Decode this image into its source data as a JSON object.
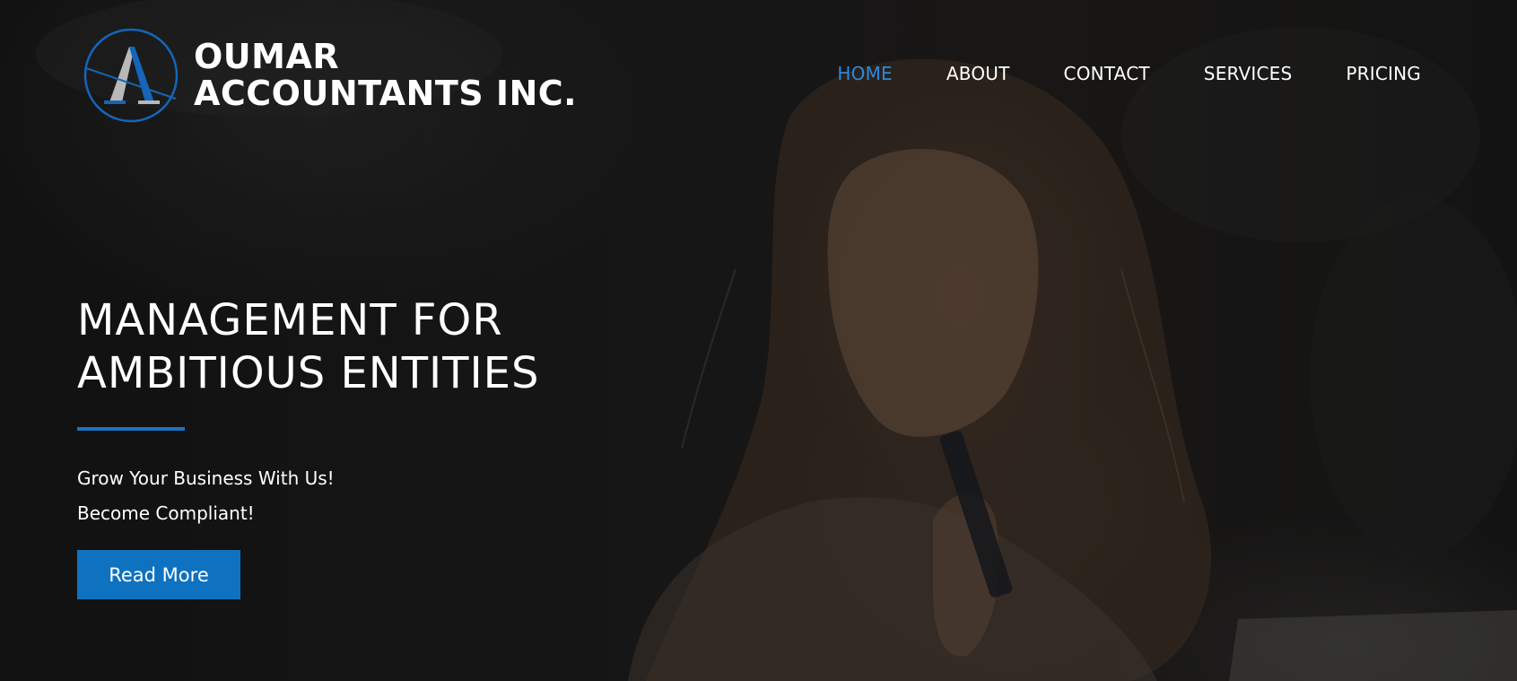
{
  "brand": {
    "line1": "OUMAR",
    "line2": "ACCOUNTANTS INC.",
    "logo_icon": "letter-a-circle-logo",
    "colors": {
      "accent": "#1a73c0",
      "logo_blue": "#1565b8",
      "logo_gray": "#b8b8b8"
    }
  },
  "nav": {
    "items": [
      {
        "label": "HOME",
        "active": true
      },
      {
        "label": "ABOUT",
        "active": false
      },
      {
        "label": "CONTACT",
        "active": false
      },
      {
        "label": "SERVICES",
        "active": false
      },
      {
        "label": "PRICING",
        "active": false
      }
    ],
    "active_color": "#2a8ae0"
  },
  "hero": {
    "headline_line1": "MANAGEMENT FOR",
    "headline_line2": "AMBITIOUS ENTITIES",
    "tagline1": "Grow Your Business With Us!",
    "tagline2": "Become Compliant!",
    "cta_label": "Read More",
    "cta_color": "#0e72c0"
  }
}
